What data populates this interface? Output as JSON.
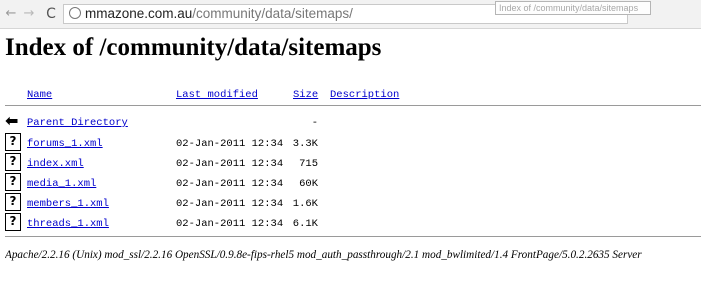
{
  "browser": {
    "back_icon": "←",
    "forward_icon": "→",
    "reload_icon": "C",
    "url_domain": "mmazone.com.au",
    "url_path": "/community/data/sitemaps/",
    "tooltip": "Index of /community/data/sitemaps"
  },
  "page": {
    "title": "Index of /community/data/sitemaps"
  },
  "columns": {
    "name": "Name",
    "last_modified": "Last modified",
    "size": "Size",
    "description": "Description"
  },
  "parent": {
    "label": "Parent Directory",
    "size": "-",
    "icon": "back-arrow-icon"
  },
  "files": [
    {
      "name": "forums_1.xml",
      "modified": "02-Jan-2011 12:34",
      "size": "3.3K",
      "icon": "unknown-file-icon"
    },
    {
      "name": "index.xml",
      "modified": "02-Jan-2011 12:34",
      "size": "715",
      "icon": "unknown-file-icon"
    },
    {
      "name": "media_1.xml",
      "modified": "02-Jan-2011 12:34",
      "size": "60K",
      "icon": "unknown-file-icon"
    },
    {
      "name": "members_1.xml",
      "modified": "02-Jan-2011 12:34",
      "size": "1.6K",
      "icon": "unknown-file-icon"
    },
    {
      "name": "threads_1.xml",
      "modified": "02-Jan-2011 12:34",
      "size": "6.1K",
      "icon": "unknown-file-icon"
    }
  ],
  "footer": "Apache/2.2.16 (Unix) mod_ssl/2.2.16 OpenSSL/0.9.8e-fips-rhel5 mod_auth_passthrough/2.1 mod_bwlimited/1.4 FrontPage/5.0.2.2635 Server",
  "colors": {
    "link": "#0000cc",
    "rule": "#9a9a9a"
  }
}
